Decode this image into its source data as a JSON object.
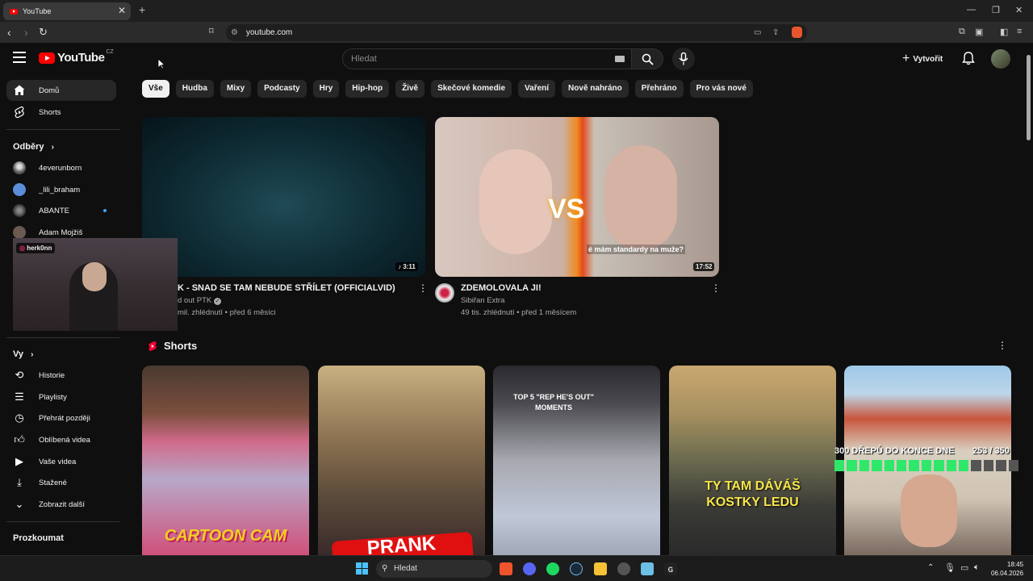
{
  "browser": {
    "tab_title": "YouTube",
    "new_tab": "+",
    "url": "youtube.com"
  },
  "header": {
    "logo_text": "YouTube",
    "logo_region": "CZ",
    "search_placeholder": "Hledat",
    "create_label": "Vytvořit"
  },
  "chips": [
    "Vše",
    "Hudba",
    "Mixy",
    "Podcasty",
    "Hry",
    "Hip-hop",
    "Živě",
    "Skečové komedie",
    "Vaření",
    "Nově nahráno",
    "Přehráno",
    "Pro vás nové"
  ],
  "sidebar": {
    "home": "Domů",
    "shorts": "Shorts",
    "subs_heading": "Odběry",
    "subscriptions": [
      "4everunborn",
      "_lili_braham",
      "ABANTE",
      "Adam Mojžiš"
    ],
    "you_heading": "Vy",
    "you_items": [
      "Historie",
      "Playlisty",
      "Přehrát později",
      "Oblíbená videa",
      "Vaše videa",
      "Stažené",
      "Zobrazit další"
    ],
    "explore_heading": "Prozkoumat"
  },
  "webcam": {
    "tag": "herk0nn"
  },
  "videos": [
    {
      "title": "K - SNAD SE TAM NEBUDE STŘÍLET (OFFICIALVID)",
      "channel": "d out PTK",
      "meta": "mil. zhlédnutí • před 6 měsíci",
      "duration": "3:11"
    },
    {
      "title": "ZDEMOLOVALA JI!",
      "channel": "Sibiřan Extra",
      "meta": "49 tis. zhlédnutí • před 1 měsícem",
      "duration": "17:52",
      "overlay_caption": "é mám standardy na muže?"
    }
  ],
  "shorts": {
    "heading": "Shorts",
    "items": [
      {
        "caption": "CARTOON CAM"
      },
      {
        "caption": "PRANK"
      },
      {
        "caption": "TOP 5 \"REP HE'S OUT\" MOMENTS"
      },
      {
        "caption": "TY TAM DÁVÁŠ KOSTKY LEDU"
      },
      {
        "caption": ""
      }
    ]
  },
  "challenge": {
    "label": "300 DŘEPŮ DO KONCE DNE",
    "counter": "253 / 350",
    "progress": 0.723
  },
  "taskbar": {
    "search": "Hledat",
    "time": "18:45",
    "date": "06.04.2026"
  }
}
